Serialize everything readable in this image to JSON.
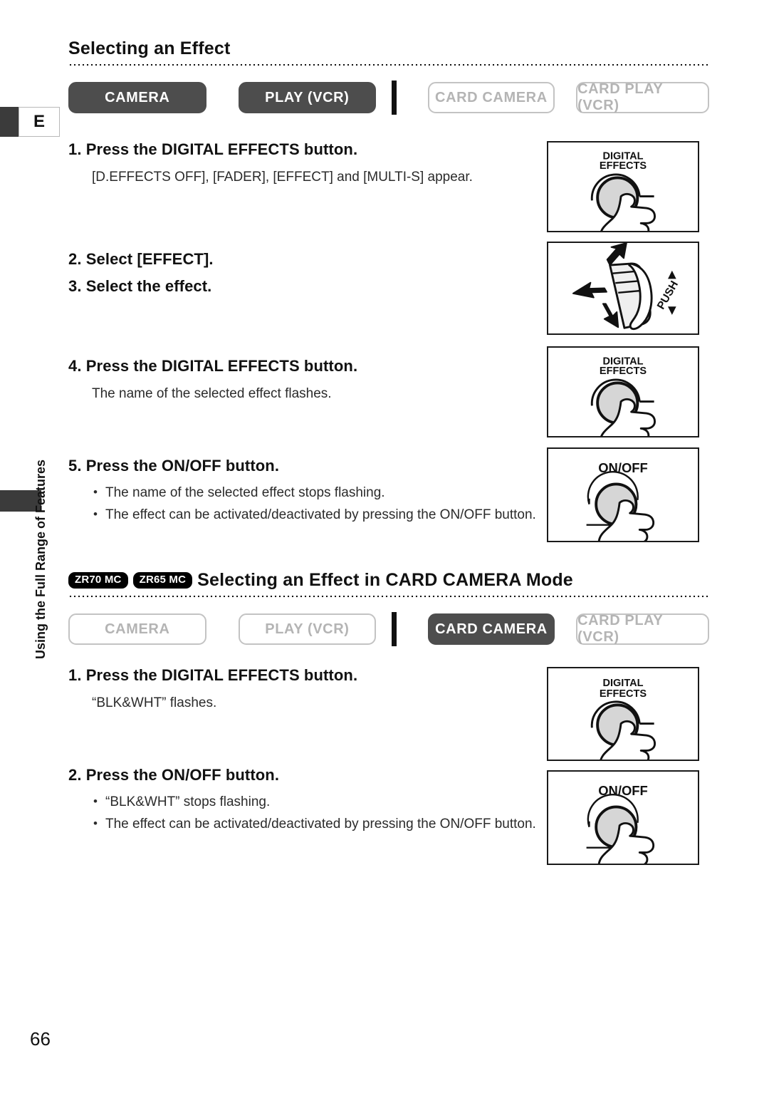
{
  "sidebar": {
    "tab_letter": "E",
    "vertical_line1": "Using the Full Range",
    "vertical_line2": "of Features",
    "page_number": "66"
  },
  "section1": {
    "title": "Selecting an Effect",
    "modes": [
      {
        "label": "CAMERA",
        "active": true
      },
      {
        "label": "PLAY (VCR)",
        "active": true
      },
      {
        "label": "CARD CAMERA",
        "active": false
      },
      {
        "label": "CARD PLAY (VCR)",
        "active": false
      }
    ],
    "steps": [
      {
        "heading": "1. Press the DIGITAL EFFECTS button.",
        "body": "[D.EFFECTS OFF], [FADER], [EFFECT] and [MULTI-S] appear."
      },
      {
        "heading": "2. Select [EFFECT]."
      },
      {
        "heading": "3. Select the effect."
      },
      {
        "heading": "4. Press the DIGITAL EFFECTS button.",
        "body": "The name of the selected effect flashes."
      },
      {
        "heading": "5. Press the ON/OFF button.",
        "bullets": [
          "The name of the selected effect stops flashing.",
          "The effect can be activated/deactivated by pressing the ON/OFF button."
        ]
      }
    ],
    "panels": [
      {
        "caption_line1": "DIGITAL",
        "caption_line2": "EFFECTS",
        "type": "button-press"
      },
      {
        "caption_line1": "PUSH",
        "caption_line2": "",
        "type": "dial-push"
      },
      {
        "caption_line1": "DIGITAL",
        "caption_line2": "EFFECTS",
        "type": "button-press"
      },
      {
        "caption_line1": "ON/OFF",
        "caption_line2": "",
        "type": "button-press"
      }
    ]
  },
  "section2": {
    "badges": [
      "ZR70 MC",
      "ZR65 MC"
    ],
    "title": "Selecting an Effect in CARD CAMERA Mode",
    "modes": [
      {
        "label": "CAMERA",
        "active": false
      },
      {
        "label": "PLAY (VCR)",
        "active": false
      },
      {
        "label": "CARD CAMERA",
        "active": true
      },
      {
        "label": "CARD PLAY (VCR)",
        "active": false
      }
    ],
    "steps": [
      {
        "heading": "1. Press the DIGITAL EFFECTS button.",
        "body": "“BLK&WHT” flashes."
      },
      {
        "heading": "2. Press the ON/OFF button.",
        "bullets": [
          "“BLK&WHT” stops flashing.",
          "The effect can be activated/deactivated by pressing the ON/OFF button."
        ]
      }
    ],
    "panels": [
      {
        "caption_line1": "DIGITAL",
        "caption_line2": "EFFECTS",
        "type": "button-press"
      },
      {
        "caption_line1": "ON/OFF",
        "caption_line2": "",
        "type": "button-press"
      }
    ]
  },
  "colors": {
    "active_mode_bg": "#4d4d4d",
    "inactive_mode_border": "#c3c3c3",
    "inactive_mode_text": "#b4b4b4",
    "ink": "#1a1a1a",
    "knob_fill": "#d6d6d6"
  }
}
